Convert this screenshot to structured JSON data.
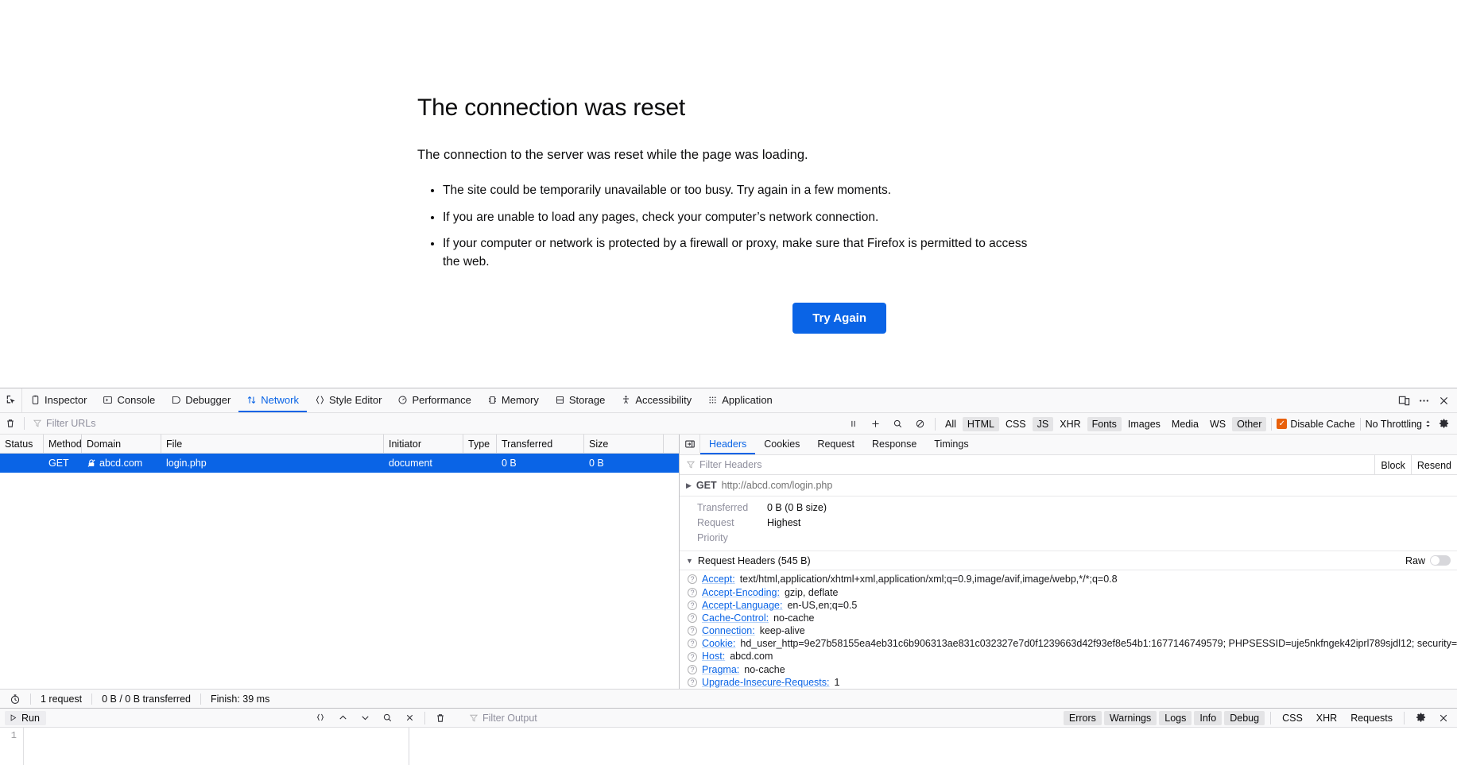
{
  "error_page": {
    "title": "The connection was reset",
    "short_desc": "The connection to the server was reset while the page was loading.",
    "bullets": [
      "The site could be temporarily unavailable or too busy. Try again in a few moments.",
      "If you are unable to load any pages, check your computer’s network connection.",
      "If your computer or network is protected by a firewall or proxy, make sure that Firefox is permitted to access the web."
    ],
    "try_again_label": "Try Again",
    "accent_color": "#0a64e6"
  },
  "devtools": {
    "tabs": [
      {
        "label": "Inspector",
        "icon": "inspector-icon",
        "active": false
      },
      {
        "label": "Console",
        "icon": "console-icon",
        "active": false
      },
      {
        "label": "Debugger",
        "icon": "debugger-icon",
        "active": false
      },
      {
        "label": "Network",
        "icon": "network-icon",
        "active": true
      },
      {
        "label": "Style Editor",
        "icon": "style-editor-icon",
        "active": false
      },
      {
        "label": "Performance",
        "icon": "performance-icon",
        "active": false
      },
      {
        "label": "Memory",
        "icon": "memory-icon",
        "active": false
      },
      {
        "label": "Storage",
        "icon": "storage-icon",
        "active": false
      },
      {
        "label": "Accessibility",
        "icon": "accessibility-icon",
        "active": false
      },
      {
        "label": "Application",
        "icon": "application-icon",
        "active": false
      }
    ],
    "toolbar_right_icons": [
      "responsive-design-mode-icon",
      "meatball-menu-icon",
      "close-icon"
    ]
  },
  "network_toolbar": {
    "clear_icon": "trash-icon",
    "filter_placeholder": "Filter URLs",
    "pause_icon": "pause-icon",
    "new_request_icon": "plus-icon",
    "search_icon": "search-icon",
    "block_icon": "block-icon",
    "filter_types": [
      {
        "label": "All",
        "active": false
      },
      {
        "label": "HTML",
        "active": true
      },
      {
        "label": "CSS",
        "active": false
      },
      {
        "label": "JS",
        "active": true
      },
      {
        "label": "XHR",
        "active": false
      },
      {
        "label": "Fonts",
        "active": true
      },
      {
        "label": "Images",
        "active": false
      },
      {
        "label": "Media",
        "active": false
      },
      {
        "label": "WS",
        "active": false
      },
      {
        "label": "Other",
        "active": true
      }
    ],
    "disable_cache_label": "Disable Cache",
    "disable_cache_checked": true,
    "disable_cache_color": "#e8600b",
    "throttling_label": "No Throttling",
    "settings_icon": "gear-icon"
  },
  "request_table": {
    "columns": [
      "Status",
      "Method",
      "Domain",
      "File",
      "Initiator",
      "Type",
      "Transferred",
      "Size"
    ],
    "rows": [
      {
        "status": "",
        "method": "GET",
        "domain": "abcd.com",
        "domain_icon": "insecure-lock-icon",
        "file": "login.php",
        "initiator": "document",
        "type": "",
        "transferred": "0 B",
        "size": "0 B",
        "selected": true
      }
    ],
    "selected_row_color": "#0a64e6"
  },
  "details_panel": {
    "tabs": [
      {
        "label": "Headers",
        "active": true
      },
      {
        "label": "Cookies",
        "active": false
      },
      {
        "label": "Request",
        "active": false
      },
      {
        "label": "Response",
        "active": false
      },
      {
        "label": "Timings",
        "active": false
      }
    ],
    "expand_icon": "expand-pane-icon",
    "filter_placeholder": "Filter Headers",
    "block_label": "Block",
    "resend_label": "Resend",
    "url_row": {
      "method": "GET",
      "url": "http://abcd.com/login.php"
    },
    "summary": [
      {
        "key": "Transferred",
        "value": "0 B (0 B size)"
      },
      {
        "key": "Request Priority",
        "value": "Highest"
      }
    ],
    "request_headers_title": "Request Headers (545 B)",
    "raw_label": "Raw",
    "raw_enabled": false,
    "request_headers": [
      {
        "name": "Accept:",
        "value": "text/html,application/xhtml+xml,application/xml;q=0.9,image/avif,image/webp,*/*;q=0.8"
      },
      {
        "name": "Accept-Encoding:",
        "value": "gzip, deflate"
      },
      {
        "name": "Accept-Language:",
        "value": "en-US,en;q=0.5"
      },
      {
        "name": "Cache-Control:",
        "value": "no-cache"
      },
      {
        "name": "Connection:",
        "value": "keep-alive"
      },
      {
        "name": "Cookie:",
        "value": "hd_user_http=9e27b58155ea4eb31c6b906313ae831c032327e7d0f1239663d42f93ef8e54b1:1677146749579; PHPSESSID=uje5nkfngek42iprl789sjdl12; security=low"
      },
      {
        "name": "Host:",
        "value": "abcd.com"
      },
      {
        "name": "Pragma:",
        "value": "no-cache"
      },
      {
        "name": "Upgrade-Insecure-Requests:",
        "value": "1"
      }
    ]
  },
  "status_bar": {
    "timer_icon": "stopwatch-icon",
    "requests": "1 request",
    "transferred": "0 B / 0 B transferred",
    "finish": "Finish: 39 ms"
  },
  "console": {
    "run_label": "Run",
    "run_icon": "play-icon",
    "mid_icons": [
      "pretty-print-icon",
      "chevron-up-icon",
      "chevron-down-icon",
      "search-icon",
      "close-icon",
      "trash-icon"
    ],
    "filter_placeholder": "Filter Output",
    "filters": [
      {
        "label": "Errors",
        "active": true
      },
      {
        "label": "Warnings",
        "active": true
      },
      {
        "label": "Logs",
        "active": true
      },
      {
        "label": "Info",
        "active": true
      },
      {
        "label": "Debug",
        "active": true
      },
      {
        "label": "CSS",
        "active": false
      },
      {
        "label": "XHR",
        "active": false
      },
      {
        "label": "Requests",
        "active": false
      }
    ],
    "settings_icon": "gear-icon",
    "close_icon": "close-icon",
    "line_number": "1"
  }
}
